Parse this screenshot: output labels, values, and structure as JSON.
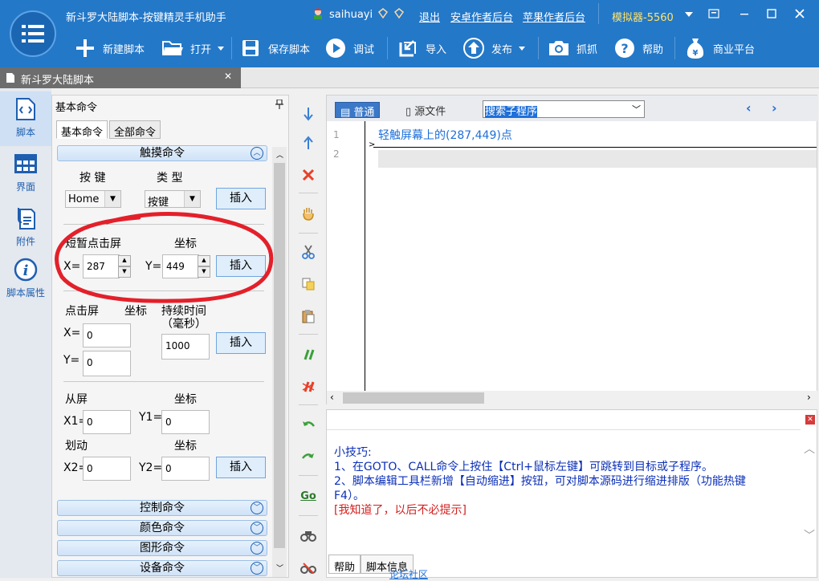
{
  "titlebar": {
    "title": "新斗罗大陆脚本-按键精灵手机助手",
    "username": "saihuayi",
    "logout": "退出",
    "android_backend": "安卓作者后台",
    "apple_backend": "苹果作者后台",
    "emulator": "模拟器-5560"
  },
  "toolbar": {
    "new_script": "新建脚本",
    "open": "打开",
    "save": "保存脚本",
    "debug": "调试",
    "import": "导入",
    "publish": "发布",
    "capture": "抓抓",
    "help": "帮助",
    "business": "商业平台"
  },
  "doc_tab": {
    "label": "新斗罗大陆脚本"
  },
  "sidebar": {
    "items": [
      {
        "label": "脚本"
      },
      {
        "label": "界面"
      },
      {
        "label": "附件"
      },
      {
        "label": "脚本属性"
      }
    ]
  },
  "panel": {
    "title": "基本命令",
    "tabs": [
      "基本命令",
      "全部命令"
    ],
    "touch_section": "触摸命令",
    "key_label": "按 键",
    "type_label": "类 型",
    "key_value": "Home",
    "type_value": "按键",
    "insert": "插入",
    "tap_label": "短暂点击屏",
    "coord": "坐标",
    "x_eq": "X=",
    "y_eq": "Y=",
    "tap_x": "287",
    "tap_y": "449",
    "press_label": "点击屏",
    "duration_label": "持续时间",
    "duration_unit": "（毫秒）",
    "press_x": "0",
    "press_y": "0",
    "duration_value": "1000",
    "from_label": "从屏",
    "swipe_label": "划动",
    "x1_eq": "X1=",
    "y1_eq": "Y1=",
    "x2_eq": "X2=",
    "y2_eq": "Y2=",
    "x1": "0",
    "y1": "0",
    "x2": "0",
    "y2": "0",
    "sections": [
      "控制命令",
      "颜色命令",
      "图形命令",
      "设备命令"
    ]
  },
  "editor": {
    "mode_normal": "普通",
    "mode_source": "源文件",
    "subroutine": "搜索子程序",
    "line_numbers": [
      "1",
      "2"
    ],
    "code_line_1": "轻触屏幕上的(287,449)点"
  },
  "tips": {
    "title": "小技巧:",
    "line1": "1、在GOTO、CALL命令上按住【Ctrl+鼠标左键】可跳转到目标或子程序。",
    "line2": "2、脚本编辑工具栏新增【自动缩进】按钮，可对脚本源码进行缩进排版（功能热键",
    "line3": "F4）。",
    "dismiss": "[我知道了，以后不必提示]",
    "tab_help": "帮助",
    "tab_info": "脚本信息",
    "community": "论坛社区"
  },
  "colors": {
    "accent": "#2478c8",
    "annotation": "#e3202a",
    "tip_text": "#0b2fb8"
  }
}
